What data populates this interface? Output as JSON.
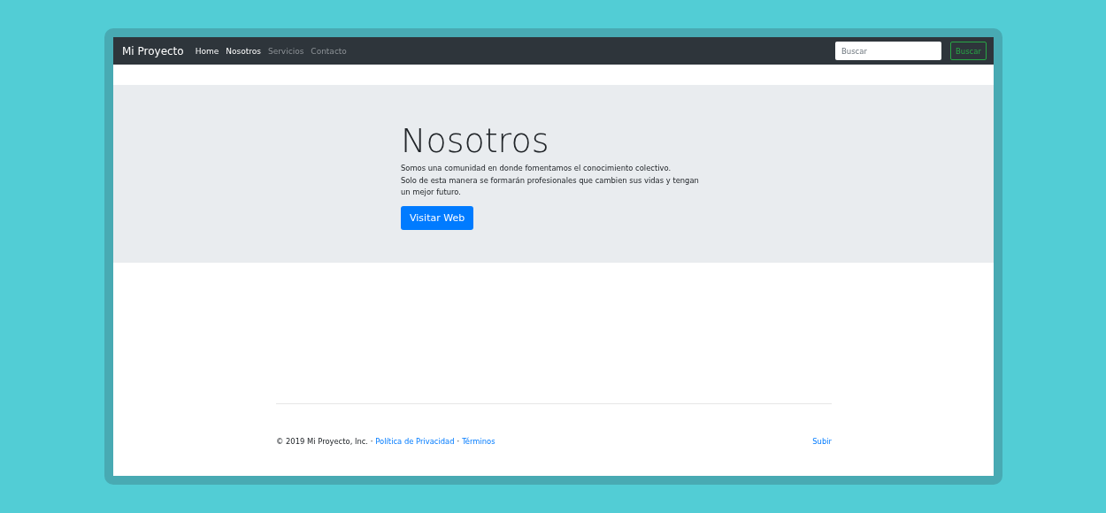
{
  "navbar": {
    "brand": "Mi Proyecto",
    "items": [
      {
        "label": "Home",
        "active": true
      },
      {
        "label": "Nosotros",
        "active": true
      },
      {
        "label": "Servicios",
        "active": false
      },
      {
        "label": "Contacto",
        "active": false
      }
    ],
    "search": {
      "placeholder": "Buscar"
    },
    "search_button": "Buscar"
  },
  "jumbotron": {
    "title": "Nosotros",
    "lines": [
      "Somos una comunidad en donde fomentamos el conocimiento colectivo.",
      "Solo de esta manera se formarán profesionales que cambien sus vidas y tengan un mejor futuro."
    ],
    "button": "Visitar Web"
  },
  "footer": {
    "copyright": "© 2019 Mi Proyecto, Inc. ·",
    "links": [
      "Política de Privacidad",
      "Términos"
    ],
    "separator": "·",
    "back_to_top": "Subir"
  }
}
